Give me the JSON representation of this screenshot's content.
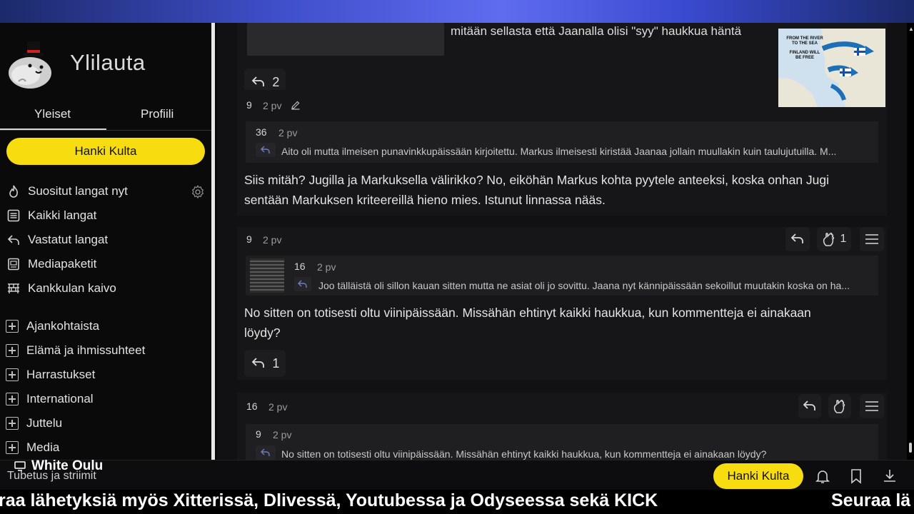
{
  "sidebar": {
    "brand": "Ylilauta",
    "tabs": [
      "Yleiset",
      "Profiili"
    ],
    "gold_button": "Hanki Kulta",
    "nav": [
      {
        "label": "Suositut langat nyt",
        "icon": "fire-icon"
      },
      {
        "label": "Kaikki langat",
        "icon": "list-icon"
      },
      {
        "label": "Vastatut langat",
        "icon": "reply-icon"
      },
      {
        "label": "Mediapaketit",
        "icon": "media-icon"
      },
      {
        "label": "Kankkulan kaivo",
        "icon": "well-icon"
      }
    ],
    "categories": [
      "Ajankohtaista",
      "Elämä ja ihmissuhteet",
      "Harrastukset",
      "International",
      "Juttelu",
      "Media"
    ]
  },
  "main": {
    "top_fragment": "mitään sellasta että Jaanalla olisi \"syy\" haukkua häntä",
    "top_reply_count": "2",
    "posts": [
      {
        "num": "9",
        "time": "2 pv",
        "quote_num": "36",
        "quote_time": "2 pv",
        "quote_text": "Aito oli mutta ilmeisen punavinkkupäissään kirjoitettu. Markus ilmeisesti kiristää Jaanaa jollain muullakin kuin taulujutuilla. M...",
        "body_line1": "Siis mitäh? Jugilla ja Markuksella välirikko? No, eiköhän Markus kohta pyytele anteeksi, koska onhan Jugi",
        "body_line2": "sentään Markuksen kriteereillä hieno mies. Istunut linnassa nääs."
      },
      {
        "num": "9",
        "time": "2 pv",
        "reaction_count": "1",
        "quote_num": "16",
        "quote_time": "2 pv",
        "quote_text": "Joo tälläistä oli sillon kauan sitten mutta ne asiat oli jo sovittu. Jaana nyt kännipäissään sekoillut muutakin koska on ha...",
        "body_line1": "No sitten on totisesti oltu viinipäissään. Missähän ehtinyt kaikki haukkua, kun kommentteja ei ainakaan",
        "body_line2": "löydy?",
        "reply_count": "1"
      },
      {
        "num": "16",
        "time": "2 pv",
        "quote_num": "9",
        "quote_time": "2 pv",
        "quote_text": "No sitten on totisesti oltu viinipäissään. Missähän ehtinyt kaikki haukkua, kun kommentteja ei ainakaan löydy?"
      }
    ]
  },
  "overlay": {
    "line1": "FROM THE RIVER",
    "line2": "TO THE SEA",
    "line3": "FINLAND WILL",
    "line4": "BE FREE"
  },
  "bottom": {
    "stream_name": "White Oulu",
    "stream_sub": "Tubetus ja striimit",
    "gold_button": "Hanki Kulta",
    "ticker": "raa lähetyksiä myös Xitterissä, Dlivessä, Youtubessa ja Odyseessa sekä KICK",
    "ticker_repeat": "Seuraa lä"
  },
  "colors": {
    "gold": "#f7dd10",
    "background": "#111113",
    "sidebar": "#0a0a0a"
  }
}
